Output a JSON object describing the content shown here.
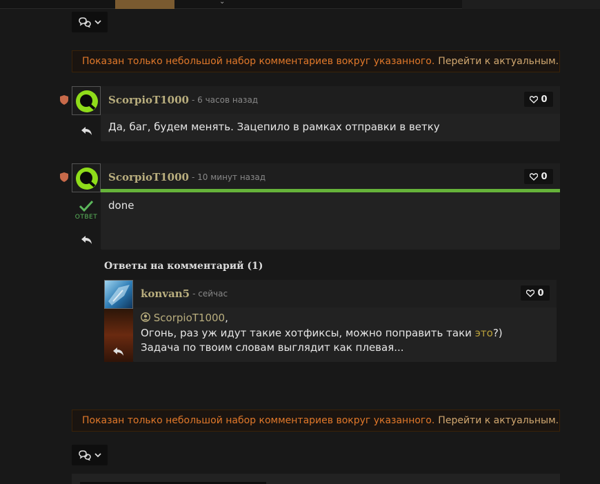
{
  "notice": {
    "warning": "Показан только небольшой набор комментариев вокруг указанного.",
    "link": "Перейти к актуальным."
  },
  "comments": [
    {
      "author": "ScorpioT1000",
      "time": "6 часов назад",
      "likes": "0",
      "text": "Да, баг, будем менять. Зацепило в рамках отправки в ветку"
    },
    {
      "author": "ScorpioT1000",
      "time": "10 минут назад",
      "likes": "0",
      "text": "done",
      "answer_label": "ОТВЕТ"
    }
  ],
  "replies": {
    "title": "Ответы на комментарий (1)",
    "items": [
      {
        "author": "konvan5",
        "time": "сейчас",
        "likes": "0",
        "mention": "ScorpioT1000",
        "mention_suffix": ",",
        "line1_before": "Огонь, раз уж идут такие хотфиксы, можно поправить таки ",
        "line1_link": "это",
        "line1_after": "?)",
        "line2": "Задача по твоим словам выглядит как плевая..."
      }
    ]
  },
  "colors": {
    "accent_green": "#66b33a",
    "warning": "#e0782a",
    "link": "#d1a870",
    "author": "#b9ae7e"
  },
  "icons": [
    "comments-icon",
    "chevron-down-icon",
    "shield-icon",
    "reply-icon",
    "heart-icon",
    "check-icon",
    "user-circle-icon"
  ]
}
